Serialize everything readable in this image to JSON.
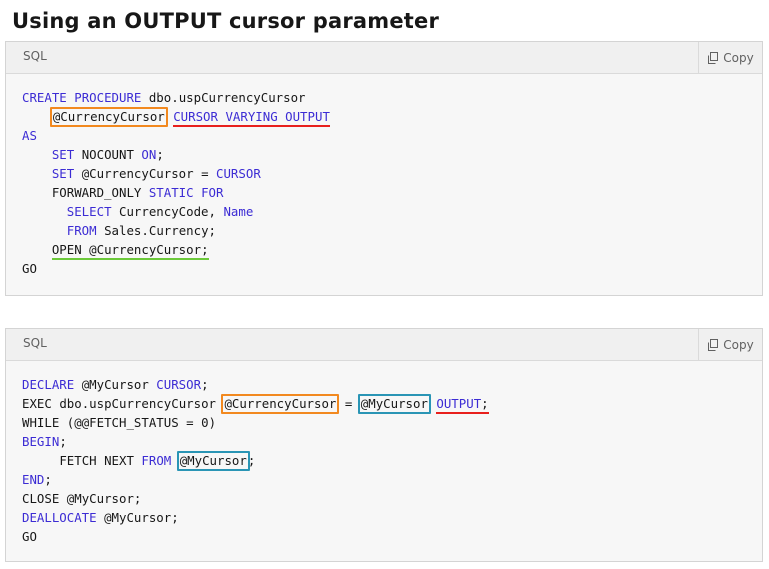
{
  "page": {
    "title": "Using an OUTPUT cursor parameter"
  },
  "colors": {
    "keyword": "#3c2cd4",
    "highlight_orange": "#f2891f",
    "highlight_blue": "#2a95b5",
    "underline_red": "#e8201d",
    "underline_green": "#6cc93a"
  },
  "blocks": [
    {
      "language": "SQL",
      "copy_label": "Copy",
      "copy_icon": "copy-icon",
      "lines": [
        "CREATE PROCEDURE dbo.uspCurrencyCursor",
        "    @CurrencyCursor CURSOR VARYING OUTPUT",
        "AS",
        "    SET NOCOUNT ON;",
        "    SET @CurrencyCursor = CURSOR",
        "    FORWARD_ONLY STATIC FOR",
        "      SELECT CurrencyCode, Name",
        "      FROM Sales.Currency;",
        "    OPEN @CurrencyCursor;",
        "GO"
      ]
    },
    {
      "language": "SQL",
      "copy_label": "Copy",
      "copy_icon": "copy-icon",
      "lines": [
        "DECLARE @MyCursor CURSOR;",
        "EXEC dbo.uspCurrencyCursor @CurrencyCursor = @MyCursor OUTPUT;",
        "WHILE (@@FETCH_STATUS = 0)",
        "BEGIN;",
        "     FETCH NEXT FROM @MyCursor;",
        "END;",
        "CLOSE @MyCursor;",
        "DEALLOCATE @MyCursor;",
        "GO"
      ]
    }
  ]
}
